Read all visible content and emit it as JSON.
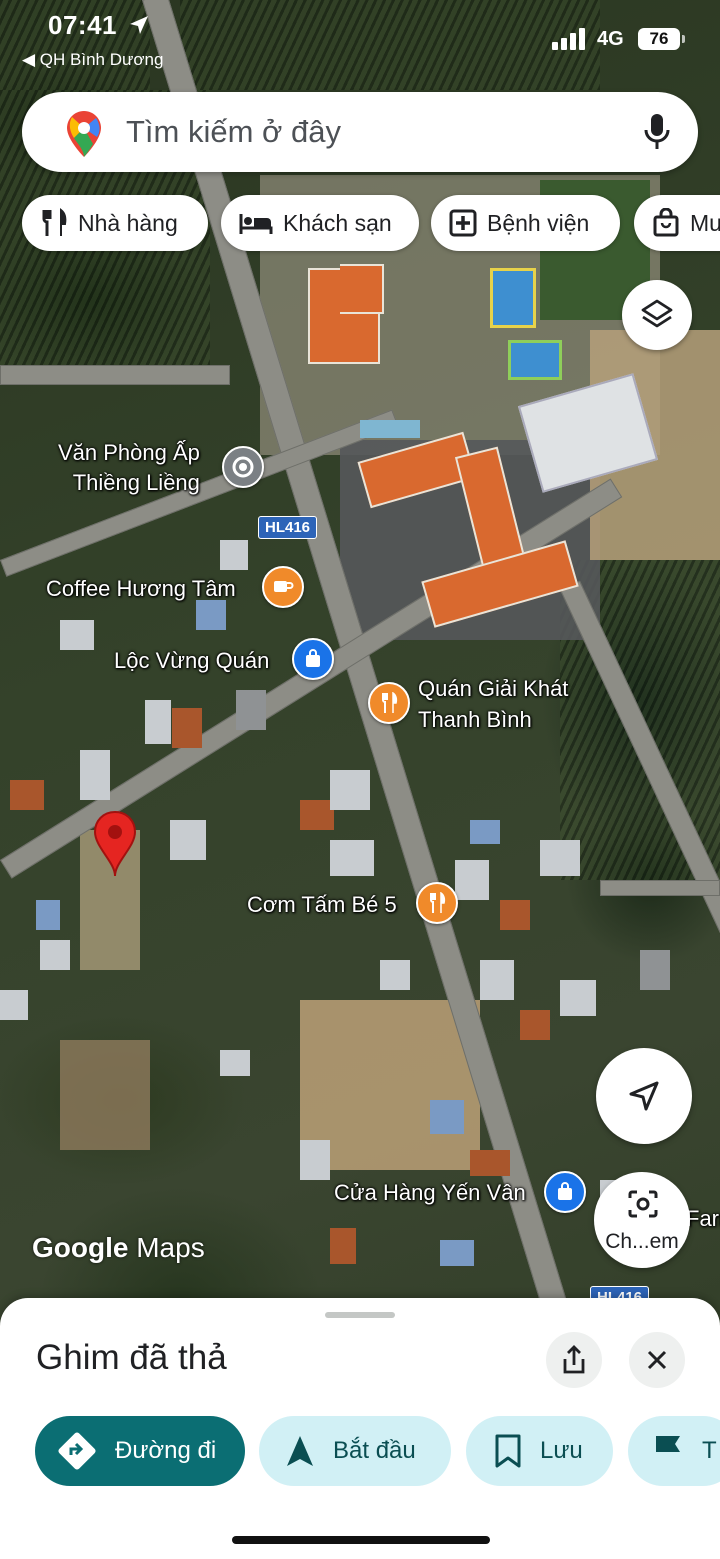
{
  "status_bar": {
    "time": "07:41",
    "back_app": "◀ QH Bình Dương",
    "network": "4G",
    "battery": "76"
  },
  "search": {
    "placeholder": "Tìm kiếm ở đây"
  },
  "chips": [
    {
      "label": "Nhà hàng",
      "icon": "fork-knife-icon"
    },
    {
      "label": "Khách sạn",
      "icon": "bed-icon"
    },
    {
      "label": "Bệnh viện",
      "icon": "hospital-icon"
    },
    {
      "label": "Mu",
      "icon": "shopping-bag-icon"
    }
  ],
  "map": {
    "road_badges": [
      "HL416",
      "HL416"
    ],
    "places": [
      {
        "name": "Văn Phòng Ấp\nThiềng Liềng",
        "icon": "office-pin-icon"
      },
      {
        "name": "Coffee Hương Tâm",
        "icon": "coffee-icon"
      },
      {
        "name": "Lộc Vừng Quán",
        "icon": "shopping-bag-icon"
      },
      {
        "name": "Quán Giải Khát\nThanh Bình",
        "icon": "fork-knife-icon"
      },
      {
        "name": "Cơm Tấm Bé 5",
        "icon": "fork-knife-icon"
      },
      {
        "name": "Cửa Hàng Yến Vân",
        "icon": "shopping-bag-icon"
      },
      {
        "name": "Farm",
        "icon": ""
      }
    ],
    "watermark_brand": "Google",
    "watermark_product": "Maps",
    "lens_label": "Ch...em"
  },
  "sheet": {
    "title": "Ghim đã thả",
    "actions": [
      {
        "label": "Đường đi",
        "icon": "directions-icon"
      },
      {
        "label": "Bắt đầu",
        "icon": "navigation-arrow-icon"
      },
      {
        "label": "Lưu",
        "icon": "bookmark-icon"
      },
      {
        "label": "T",
        "icon": "flag-icon"
      }
    ]
  },
  "colors": {
    "primary_action": "#0b6e73",
    "secondary_action": "#d1f0f5",
    "pin": "#e52521",
    "poi_food": "#f08a2a",
    "poi_shop": "#1a73e8"
  }
}
